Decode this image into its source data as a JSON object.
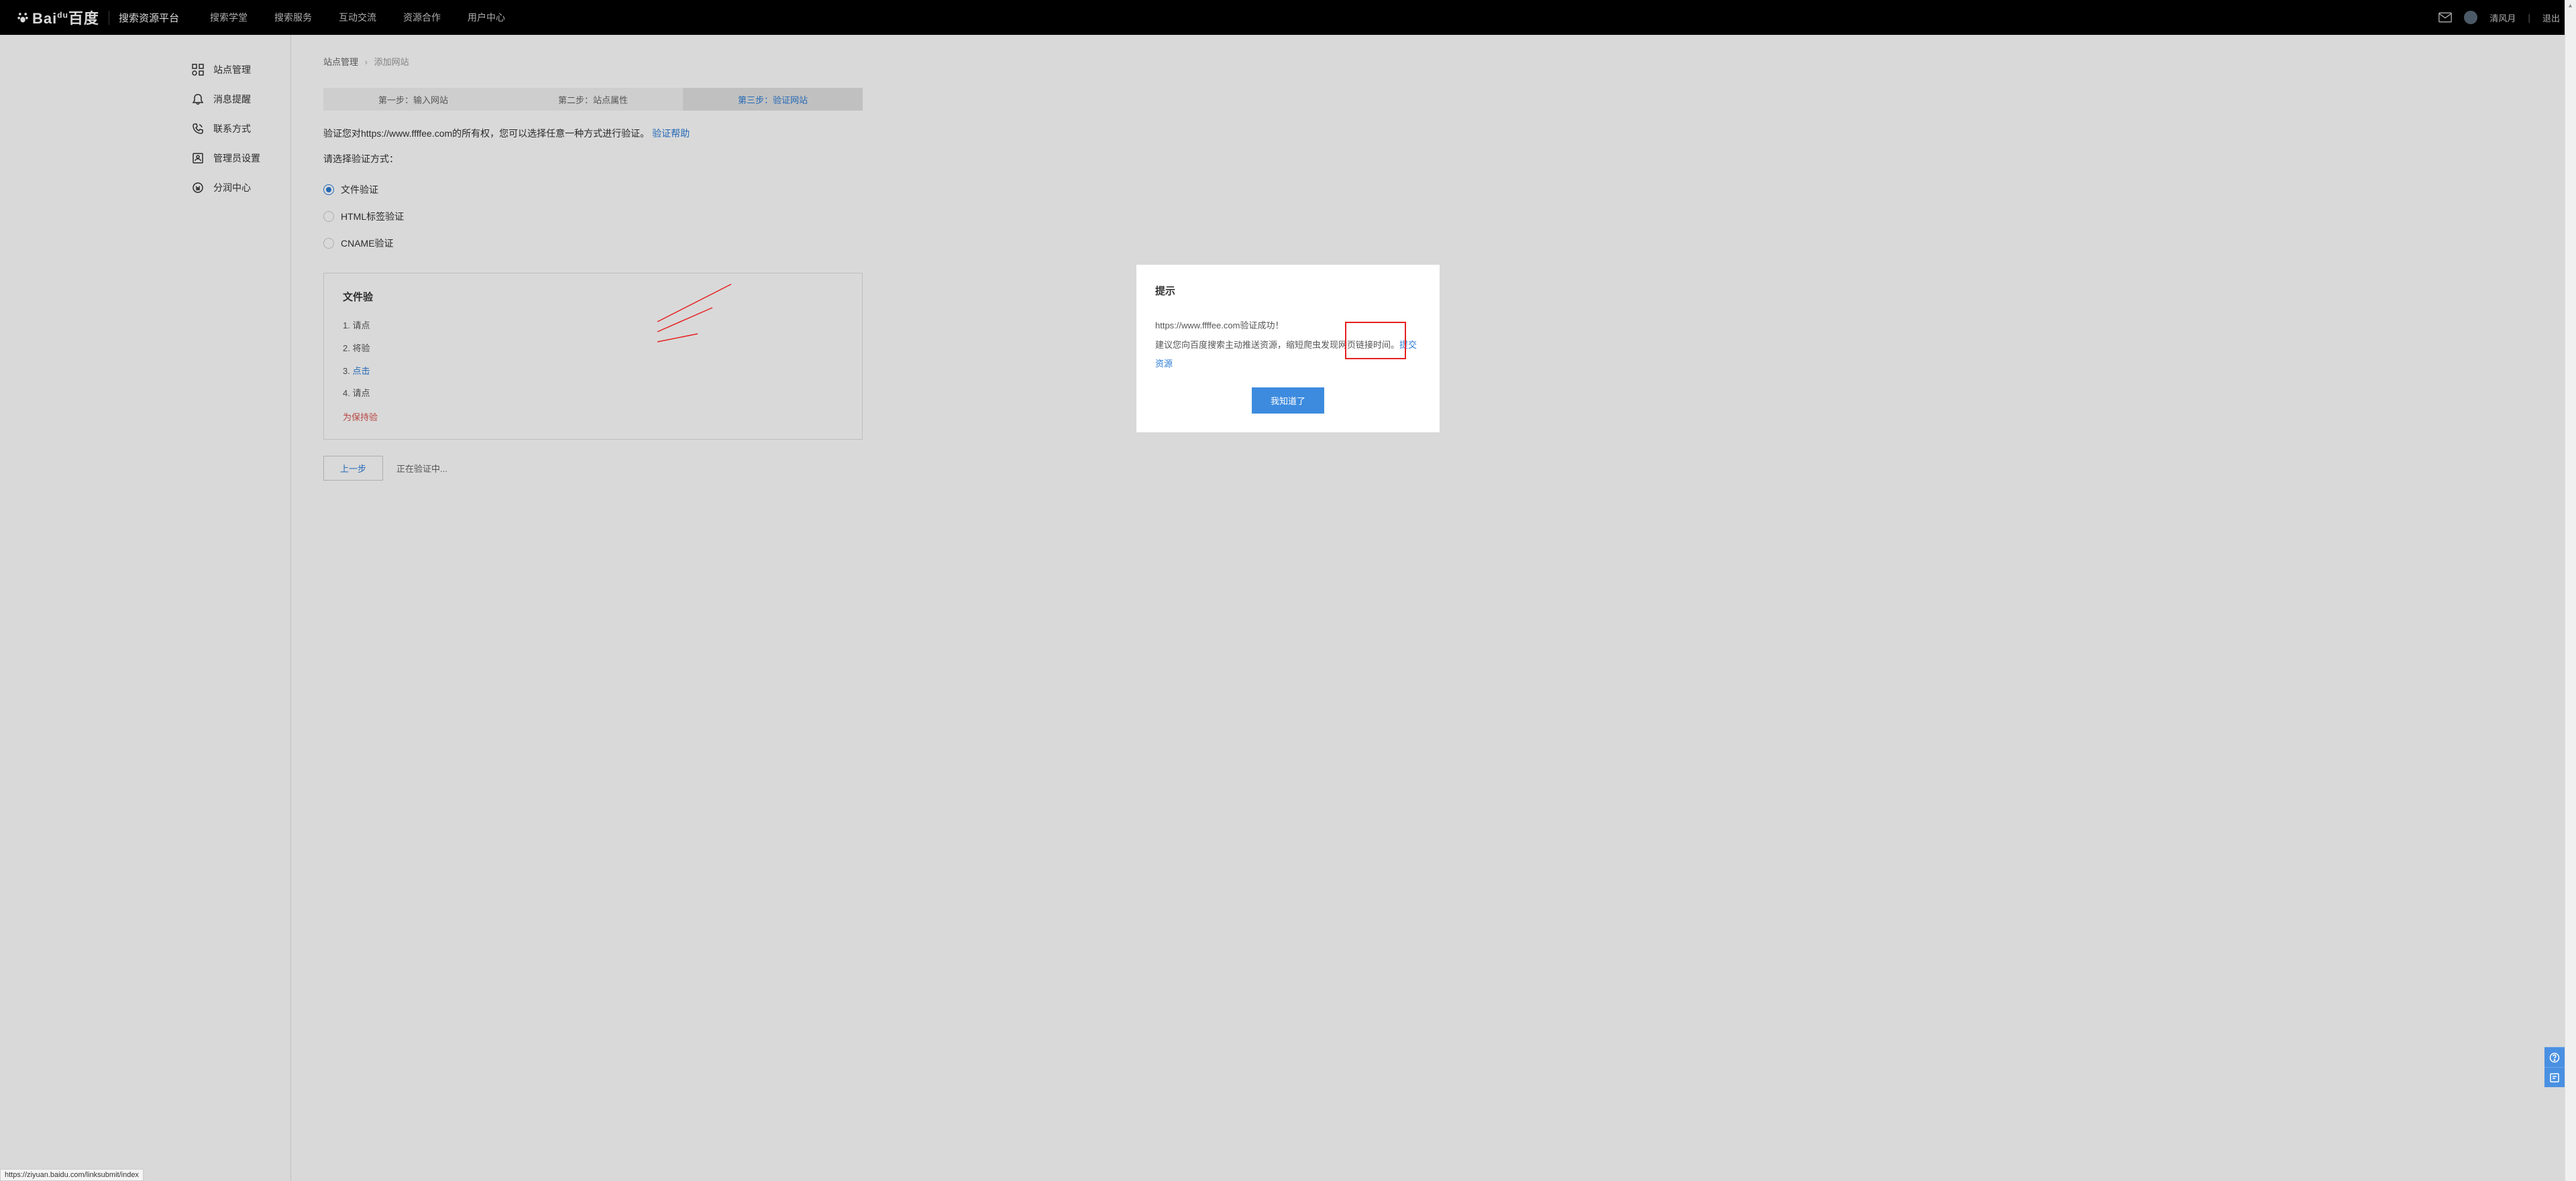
{
  "header": {
    "logo_text": "Bai",
    "logo_text2": "百度",
    "platform": "搜索资源平台",
    "nav": [
      "搜索学堂",
      "搜索服务",
      "互动交流",
      "资源合作",
      "用户中心"
    ],
    "username": "清风月",
    "logout": "退出"
  },
  "sidebar": {
    "items": [
      {
        "label": "站点管理"
      },
      {
        "label": "消息提醒"
      },
      {
        "label": "联系方式"
      },
      {
        "label": "管理员设置"
      },
      {
        "label": "分润中心"
      }
    ]
  },
  "breadcrumb": {
    "root": "站点管理",
    "current": "添加网站"
  },
  "steps": [
    "第一步：输入网站",
    "第二步：站点属性",
    "第三步：验证网站"
  ],
  "verify": {
    "text_pre": "验证您对https://www.ffffee.com的所有权，您可以选择任意一种方式进行验证。",
    "help_link": "验证帮助"
  },
  "choose_label": "请选择验证方式：",
  "radios": [
    "文件验证",
    "HTML标签验证",
    "CNAME验证"
  ],
  "panel": {
    "title": "文件验",
    "item1": "1. 请点",
    "item2": "2. 将验",
    "item3_pre": "3. ",
    "item3_link": "点击",
    "item4": "4. 请点",
    "warning": "为保持验"
  },
  "footer": {
    "prev": "上一步",
    "status": "正在验证中..."
  },
  "modal": {
    "title": "提示",
    "line1": "https://www.ffffee.com验证成功！",
    "line2_pre": "建议您向百度搜索主动推送资源，缩短爬虫发现网页链接时间。",
    "link": "提交资源",
    "ok": "我知道了"
  },
  "status_url": "https://ziyuan.baidu.com/linksubmit/index"
}
